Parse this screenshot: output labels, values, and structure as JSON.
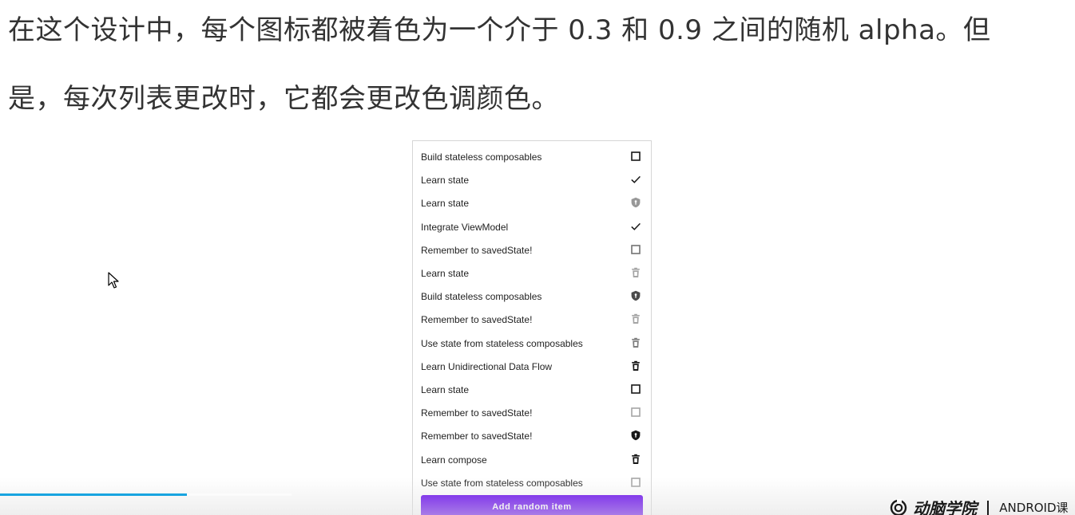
{
  "caption": {
    "line1": "在这个设计中，每个图标都被着色为一个介于 0.3 和 0.9 之间的随机 alpha。但",
    "line2": "是，每次列表更改时，它都会更改色调颜色。"
  },
  "todo_list": {
    "items": [
      {
        "label": "Build stateless composables",
        "icon": "checkbox-outline-icon",
        "alpha": 0.9
      },
      {
        "label": "Learn state",
        "icon": "check-icon",
        "alpha": 0.9
      },
      {
        "label": "Learn state",
        "icon": "privacy-shield-icon",
        "alpha": 0.4
      },
      {
        "label": "Integrate ViewModel",
        "icon": "check-icon",
        "alpha": 0.9
      },
      {
        "label": "Remember to savedState!",
        "icon": "checkbox-outline-icon",
        "alpha": 0.55
      },
      {
        "label": "Learn state",
        "icon": "trash-can-icon",
        "alpha": 0.35
      },
      {
        "label": "Build stateless composables",
        "icon": "privacy-shield-icon",
        "alpha": 0.7
      },
      {
        "label": "Remember to savedState!",
        "icon": "trash-can-icon",
        "alpha": 0.35
      },
      {
        "label": "Use state from stateless composables",
        "icon": "trash-can-icon",
        "alpha": 0.5
      },
      {
        "label": "Learn Unidirectional Data Flow",
        "icon": "trash-can-icon",
        "alpha": 0.9
      },
      {
        "label": "Learn state",
        "icon": "checkbox-outline-icon",
        "alpha": 0.9
      },
      {
        "label": "Remember to savedState!",
        "icon": "checkbox-outline-icon",
        "alpha": 0.35
      },
      {
        "label": "Remember to savedState!",
        "icon": "privacy-shield-icon",
        "alpha": 0.9
      },
      {
        "label": "Learn compose",
        "icon": "trash-can-icon",
        "alpha": 0.9
      },
      {
        "label": "Use state from stateless composables",
        "icon": "checkbox-outline-icon",
        "alpha": 0.35
      }
    ],
    "add_button_label": "Add random item"
  },
  "video": {
    "progress": 0.64
  },
  "watermark": {
    "name": "动脑学院",
    "tag": "ANDROID课"
  },
  "colors": {
    "accent": "#6200ee",
    "progress": "#18a4e0",
    "icon_tint": "#000000"
  }
}
